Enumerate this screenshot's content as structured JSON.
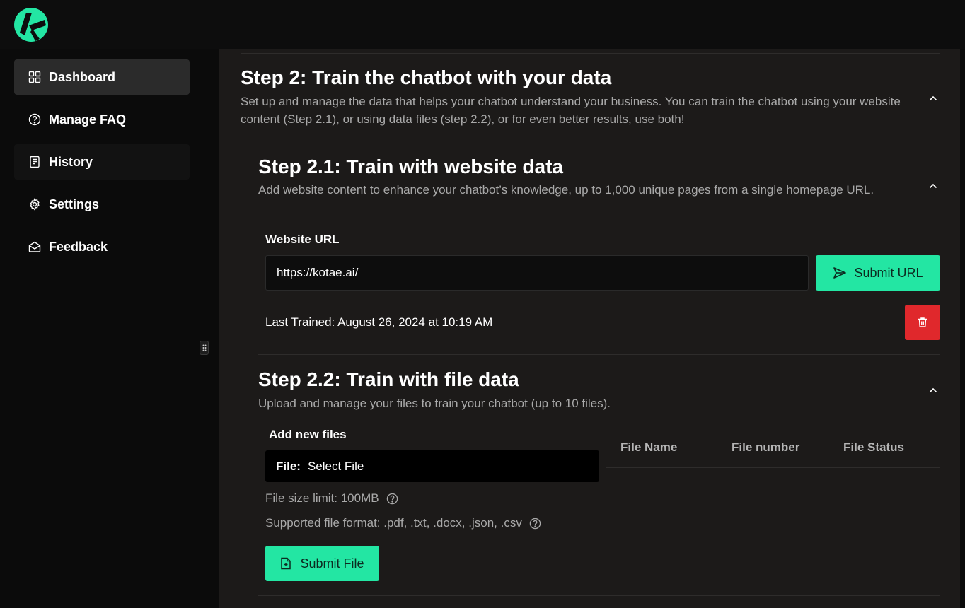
{
  "app": {
    "logo_icon": "kotae-logo-icon",
    "brand_color": "#23e6a3"
  },
  "sidebar": {
    "items": [
      {
        "label": "Dashboard",
        "icon": "grid-icon",
        "active": true
      },
      {
        "label": "Manage FAQ",
        "icon": "help-circle-icon"
      },
      {
        "label": "History",
        "icon": "document-icon"
      },
      {
        "label": "Settings",
        "icon": "gear-icon"
      },
      {
        "label": "Feedback",
        "icon": "envelope-open-icon"
      }
    ]
  },
  "step2": {
    "title": "Step 2: Train the chatbot with your data",
    "description": "Set up and manage the data that helps your chatbot understand your business. You can train the chatbot using your website content (Step 2.1), or using data files (step 2.2), or for even better results, use both!"
  },
  "step21": {
    "title": "Step 2.1: Train with website data",
    "description": "Add website content to enhance your chatbot’s knowledge, up to 1,000 unique pages from a single homepage URL.",
    "url_label": "Website URL",
    "url_value": "https://kotae.ai/",
    "submit_label": "Submit URL",
    "last_trained": "Last Trained: August 26, 2024 at 10:19 AM"
  },
  "step22": {
    "title": "Step 2.2: Train with file data",
    "description": "Upload and manage your files to train your chatbot (up to 10 files).",
    "add_label": "Add new files",
    "file_prefix": "File:",
    "file_placeholder": "Select File",
    "size_limit": "File size limit: 100MB",
    "formats": "Supported file format: .pdf, .txt, .docx, .json, .csv",
    "submit_label": "Submit File",
    "table_headers": [
      "File Name",
      "File number",
      "File Status"
    ]
  },
  "colors": {
    "danger": "#e0282c",
    "panel": "#1c1a19"
  }
}
